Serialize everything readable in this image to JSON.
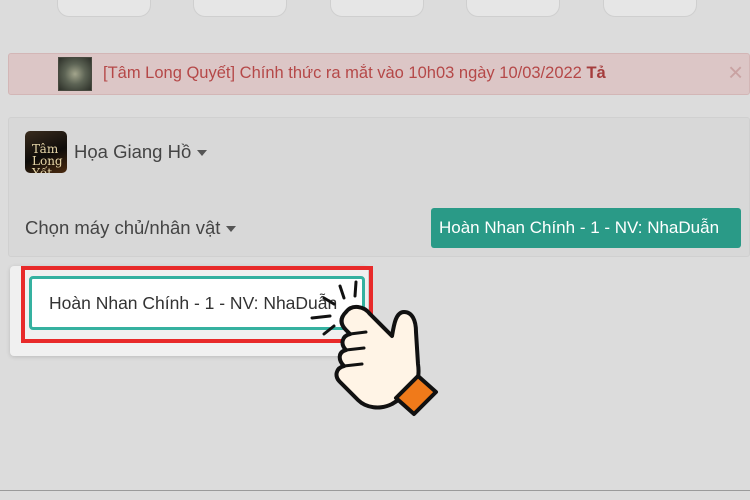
{
  "announcement": {
    "text": "[Tâm Long Quyết] Chính thức ra mắt vào 10h03 ngày 10/03/2022 ",
    "text_tail": "Tả",
    "close_glyph": "×"
  },
  "game_icon": {
    "label": "Tâm Long Yết"
  },
  "game_select": {
    "label": "Họa Giang Hồ"
  },
  "server_select": {
    "label": "Chọn máy chủ/nhân vật"
  },
  "selected_character": {
    "label": "Hoàn Nhan Chính - 1 - NV: NhaDuẫn"
  },
  "dropdown": {
    "options": [
      {
        "label": "Hoàn Nhan Chính - 1 - NV: NhaDuẫn"
      }
    ]
  },
  "colors": {
    "accent": "#2a9a87",
    "highlight": "#e82a2a",
    "announce_text": "#b54848"
  },
  "icons": [
    "game-thumbnail",
    "caret-down-icon",
    "close-icon",
    "pointing-hand-icon"
  ]
}
